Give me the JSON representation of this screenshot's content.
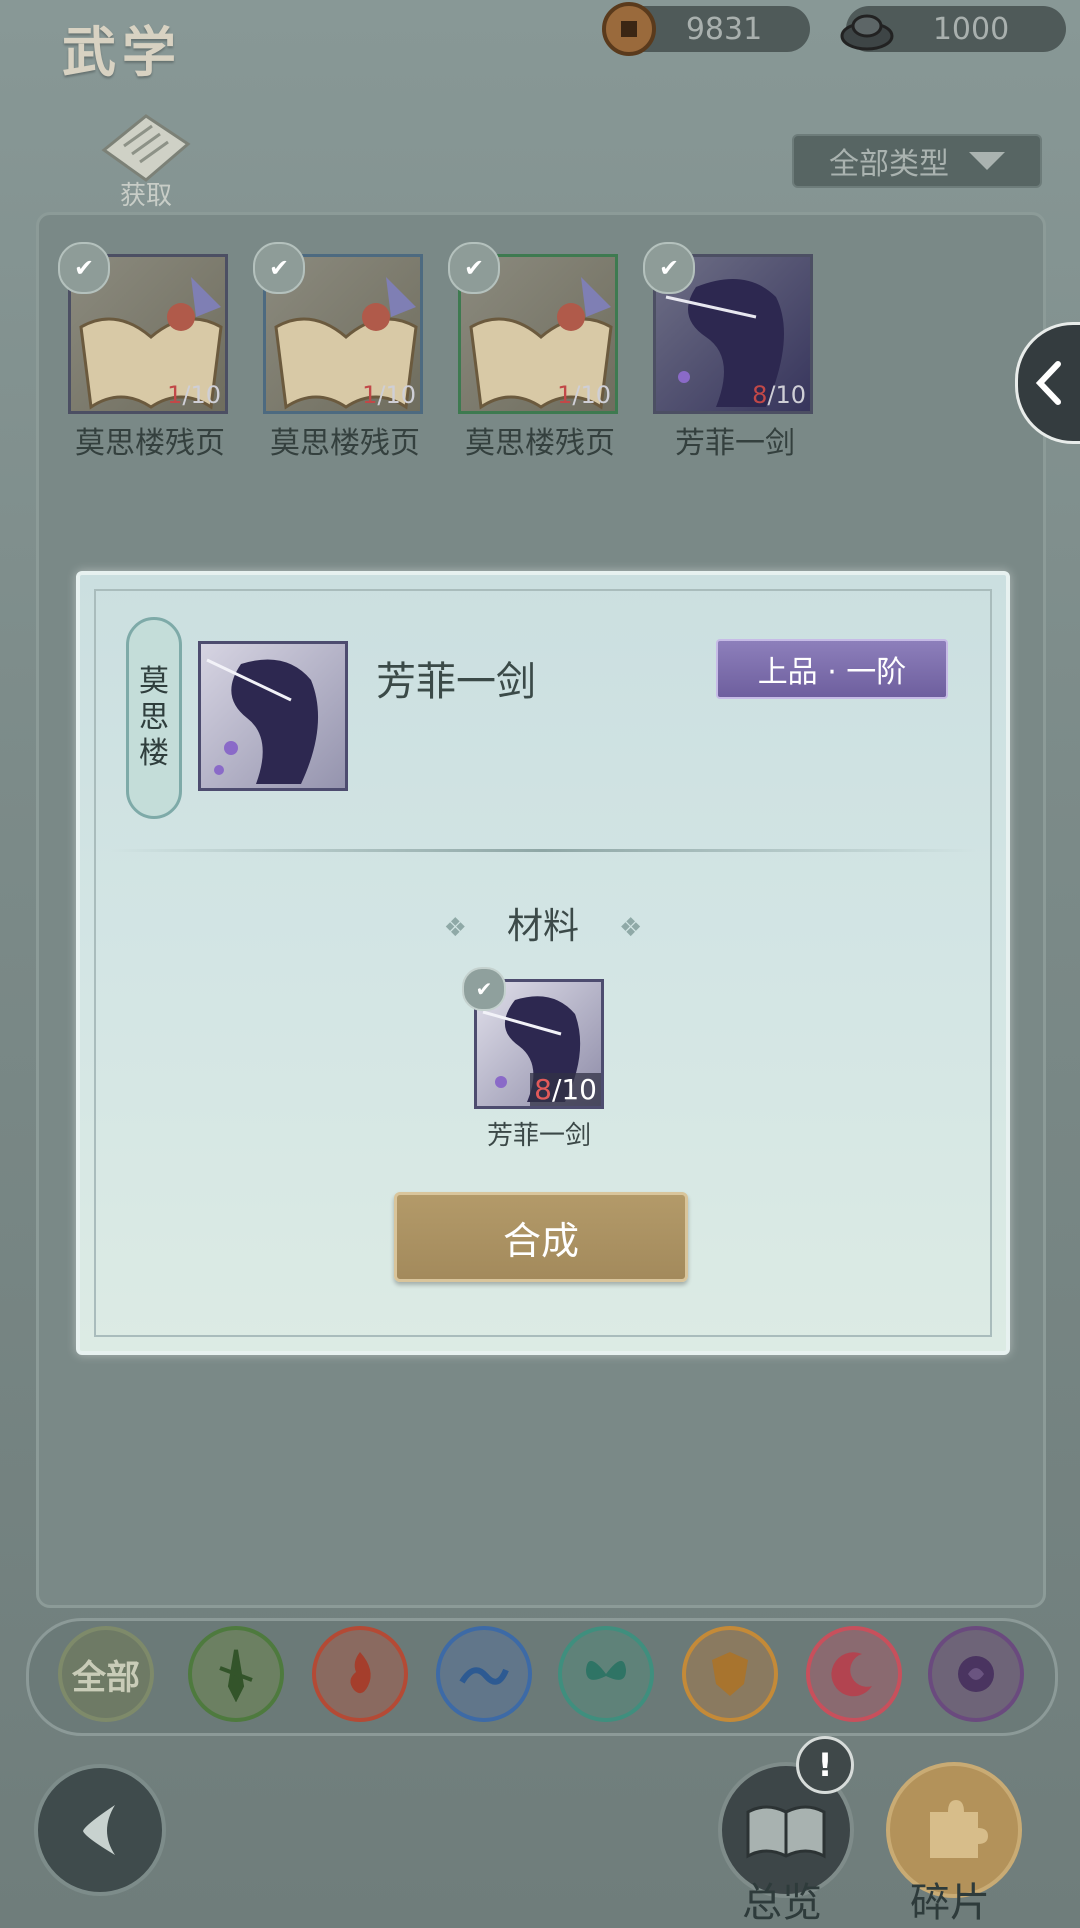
{
  "header": {
    "title": "武学",
    "currencies": [
      {
        "icon": "copper-coin-icon",
        "value": "9831"
      },
      {
        "icon": "silver-ingot-icon",
        "value": "1000"
      }
    ]
  },
  "acquire": {
    "label": "获取"
  },
  "filter": {
    "label": "全部类型"
  },
  "fragments": [
    {
      "name": "莫思楼残页",
      "count": "1",
      "total": "/10"
    },
    {
      "name": "莫思楼残页",
      "count": "1",
      "total": "/10"
    },
    {
      "name": "莫思楼残页",
      "count": "1",
      "total": "/10"
    },
    {
      "name": "芳菲一剑",
      "count": "8",
      "total": "/10"
    }
  ],
  "dialog": {
    "sect": [
      "莫",
      "思",
      "楼"
    ],
    "skill_name": "芳菲一剑",
    "grade": "上品 · 一阶",
    "materials_title": "材料",
    "material": {
      "name": "芳菲一剑",
      "count": "8",
      "total": "/10"
    },
    "synthesize": "合成"
  },
  "categories": [
    {
      "label": "全部",
      "icon": "all-icon",
      "color": "#7e8a6a"
    },
    {
      "label": "",
      "icon": "sword-icon",
      "color": "#4e7a3e"
    },
    {
      "label": "",
      "icon": "flame-icon",
      "color": "#b44a35"
    },
    {
      "label": "",
      "icon": "wave-icon",
      "color": "#3d6aa6"
    },
    {
      "label": "",
      "icon": "butterfly-icon",
      "color": "#3f8f7e"
    },
    {
      "label": "",
      "icon": "shield-icon",
      "color": "#c48a38"
    },
    {
      "label": "",
      "icon": "moon-icon",
      "color": "#c8505c"
    },
    {
      "label": "",
      "icon": "rose-icon",
      "color": "#6a4a7e"
    }
  ],
  "bottom": {
    "overview_label": "总览",
    "fragments_label": "碎片",
    "alert": "!"
  }
}
